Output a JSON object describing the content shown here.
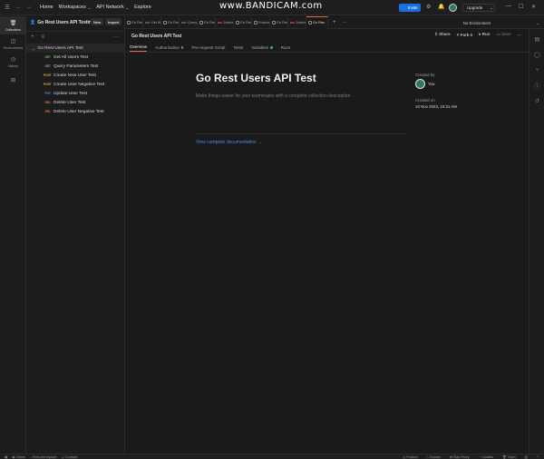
{
  "topbar": {
    "nav": [
      "Home",
      "Workspaces",
      "API Network",
      "Explore"
    ],
    "watermark": "www.BANDICAM.com",
    "invite_label": "Invite",
    "upgrade_label": "Upgrade"
  },
  "leftrail": {
    "items": [
      "Collections",
      "Environments",
      "History"
    ]
  },
  "sidebar": {
    "workspace_name": "Go Rest Users API Testing",
    "new_label": "New",
    "import_label": "Import",
    "collection_name": "Go Rest Users API Test",
    "requests": [
      {
        "method": "GET",
        "name": "Get All Users Test"
      },
      {
        "method": "GET",
        "name": "Query Parameters Test"
      },
      {
        "method": "POST",
        "name": "Create New User Test"
      },
      {
        "method": "POST",
        "name": "Create User Negative Test"
      },
      {
        "method": "PUT",
        "name": "Update User Test"
      },
      {
        "method": "DEL",
        "name": "Delete User Test"
      },
      {
        "method": "DEL",
        "name": "Delete User Negative Test"
      }
    ]
  },
  "tabs": [
    {
      "method": "",
      "label": "Go Res"
    },
    {
      "method": "GET",
      "label": "Get Al"
    },
    {
      "method": "",
      "label": "Go Res"
    },
    {
      "method": "GET",
      "label": "Query"
    },
    {
      "method": "",
      "label": "Go Res"
    },
    {
      "method": "DEL",
      "label": "Delete"
    },
    {
      "method": "",
      "label": "Go Res"
    },
    {
      "method": "",
      "label": "Postma"
    },
    {
      "method": "",
      "label": "Go Res"
    },
    {
      "method": "DEL",
      "label": "Delete"
    },
    {
      "method": "",
      "label": "Go Res"
    }
  ],
  "environment": "No Environment",
  "main": {
    "header_title": "Go Rest Users API Test",
    "actions": {
      "share": "Share",
      "fork": "Fork",
      "fork_count": "0",
      "run": "Run",
      "save": "Save"
    },
    "subtabs": [
      "Overview",
      "Authorization",
      "Pre-request Script",
      "Tests",
      "Variables",
      "Runs"
    ],
    "title": "Go Rest Users API Test",
    "description": "Make things easier for your teammates with a complete collection description.",
    "doc_link": "View complete documentation →",
    "created_by_label": "Created by",
    "created_by_value": "You",
    "created_on_label": "Created on",
    "created_on_value": "10 Nov 2023, 10:31 AM"
  },
  "statusbar": {
    "left": [
      "Online",
      "Find and replace",
      "Console"
    ],
    "right": [
      "Postbot",
      "Runner",
      "Start Proxy",
      "Cookies",
      "Trash"
    ]
  },
  "colors": {
    "accent": "#e36f3b",
    "link": "#4b8be8",
    "get": "#6bbd5b",
    "post": "#e0b040",
    "put": "#4b9cf0",
    "del": "#e86a5e"
  }
}
